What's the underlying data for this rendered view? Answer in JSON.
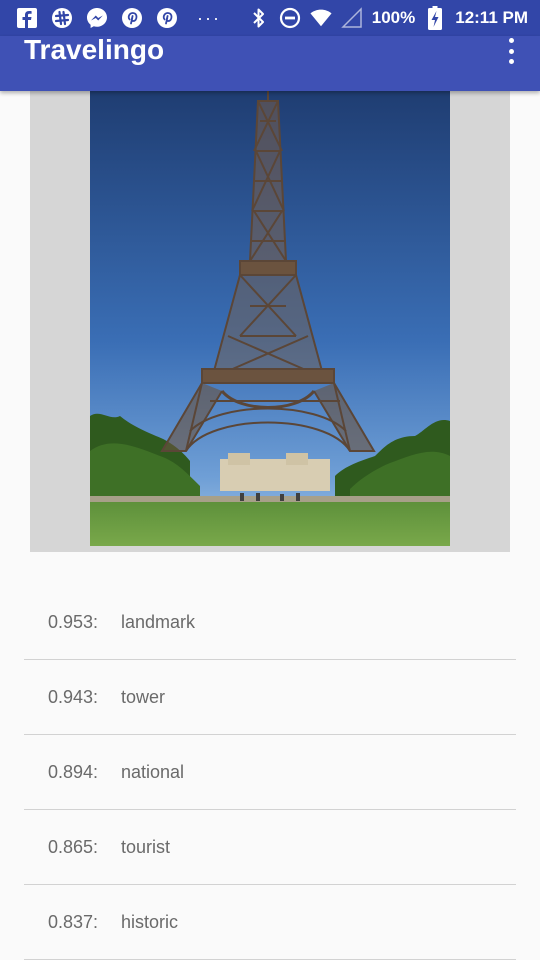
{
  "status_bar": {
    "battery": "100%",
    "time": "12:11 PM",
    "more": "···"
  },
  "app_bar": {
    "title": "Travelingo"
  },
  "image": {
    "subject": "Eiffel Tower"
  },
  "labels": [
    {
      "score": "0.953:",
      "name": "landmark"
    },
    {
      "score": "0.943:",
      "name": "tower"
    },
    {
      "score": "0.894:",
      "name": "national"
    },
    {
      "score": "0.865:",
      "name": "tourist"
    },
    {
      "score": "0.837:",
      "name": "historic"
    }
  ],
  "colors": {
    "status_bar": "#3246a8",
    "app_bar": "#3f51b5",
    "text_secondary": "#6a6a6a"
  }
}
